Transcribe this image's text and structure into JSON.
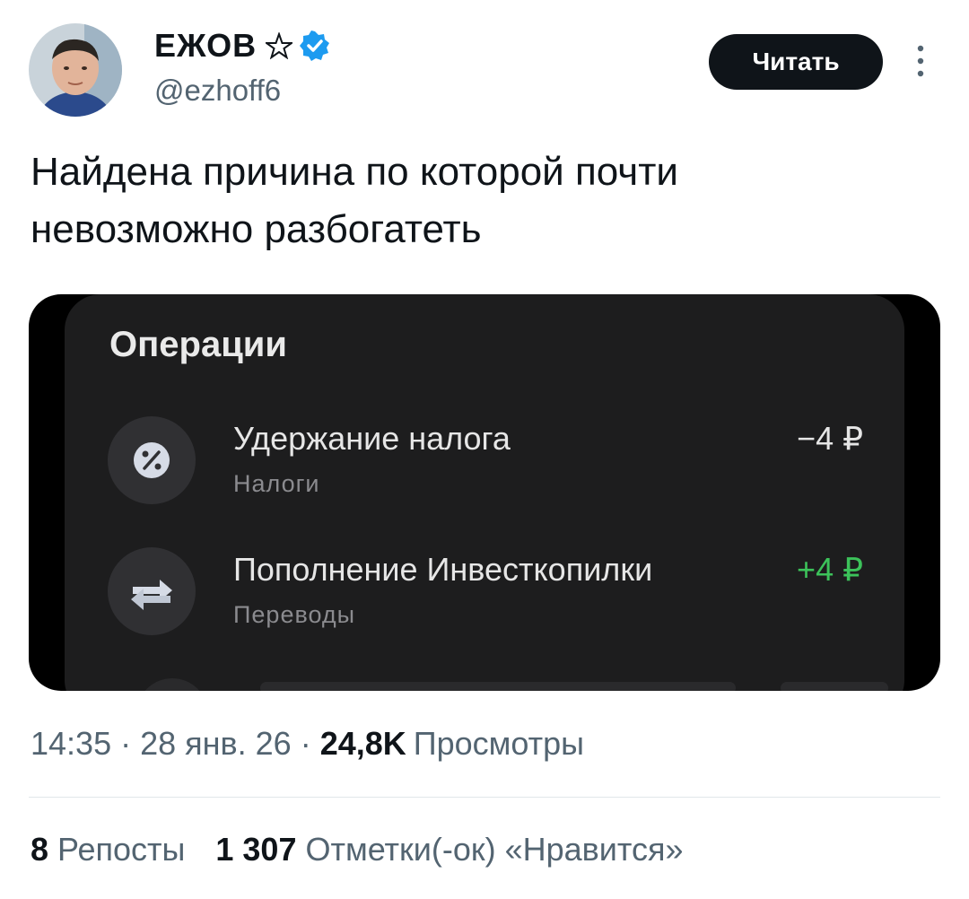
{
  "author": {
    "display_name": "ЕЖОВ",
    "handle": "@ezhoff6"
  },
  "header": {
    "follow_label": "Читать"
  },
  "tweet": {
    "text_line1": "Найдена причина по которой почти",
    "text_line2": "невозможно разбогатеть"
  },
  "media": {
    "title": "Операции",
    "operations": [
      {
        "title": "Удержание налога",
        "category": "Налоги",
        "amount": "−4 ₽",
        "icon": "percent-icon",
        "kind": "negative"
      },
      {
        "title": "Пополнение Инвесткопилки",
        "category": "Переводы",
        "amount": "+4 ₽",
        "icon": "transfer-arrows-icon",
        "kind": "positive"
      }
    ],
    "colors": {
      "positive_amount": "#3cc25a",
      "panel_bg": "#1d1d1e"
    }
  },
  "meta": {
    "time": "14:35",
    "separator": "·",
    "date": "28 янв. 26",
    "views_count": "24,8K",
    "views_label": "Просмотры"
  },
  "stats": {
    "reposts_count": "8",
    "reposts_label": "Репосты",
    "likes_count": "1 307",
    "likes_label": "Отметки(-ок) «Нравится»"
  },
  "colors": {
    "verified": "#1d9bf0",
    "secondary_text": "#536471",
    "primary_text": "#0f1419"
  }
}
